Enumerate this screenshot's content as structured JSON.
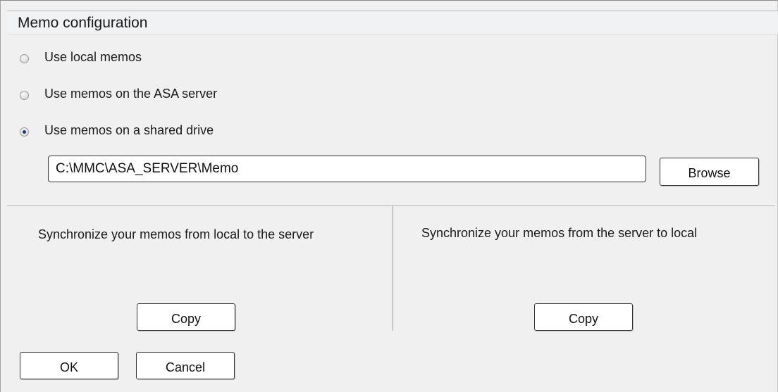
{
  "dialog": {
    "title": "Memo configuration"
  },
  "memo_source": {
    "options": [
      {
        "label": "Use local memos",
        "checked": false
      },
      {
        "label": "Use memos on the ASA server",
        "checked": false
      },
      {
        "label": "Use memos on a shared drive",
        "checked": true
      }
    ],
    "shared_drive_path": "C:\\MMC\\ASA_SERVER\\Memo",
    "browse_label": "Browse"
  },
  "sync": {
    "local_to_server": {
      "text": "Synchronize your memos from local to the server",
      "button_label": "Copy"
    },
    "server_to_local": {
      "text": "Synchronize your memos from the server to local",
      "button_label": "Copy"
    }
  },
  "footer": {
    "ok_label": "OK",
    "cancel_label": "Cancel"
  }
}
